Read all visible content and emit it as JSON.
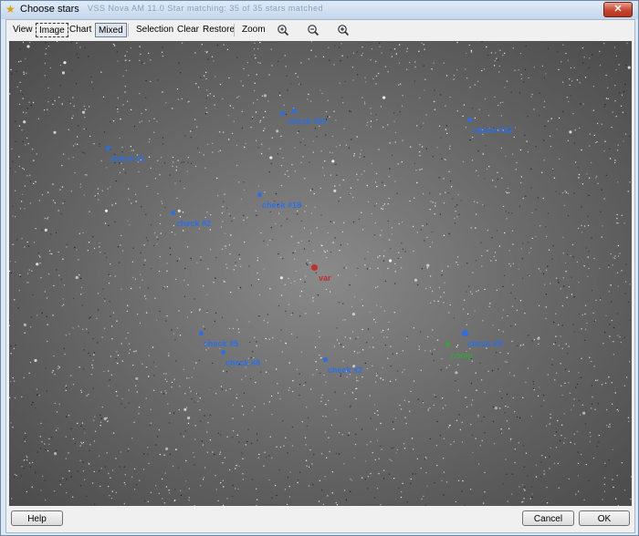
{
  "window": {
    "title": "Choose stars",
    "background_title": "VSS  Nova  AM  11.0  Star matching: 35 of 35 stars matched"
  },
  "toolbar": {
    "view": "View",
    "image": "Image",
    "chart": "Chart",
    "mixed": "Mixed",
    "selection": "Selection",
    "clear": "Clear",
    "restore": "Restore",
    "zoom": "Zoom",
    "zoom_fit_icon": "zoom-fit-icon",
    "zoom_out_icon": "zoom-out-icon",
    "zoom_in_icon": "zoom-in-icon"
  },
  "stars": [
    {
      "id": "check-31",
      "label": "check #31",
      "color": "#2a6fe8"
    },
    {
      "id": "check-33",
      "label": "check #33",
      "color": "#2a6fe8"
    },
    {
      "id": "check-41",
      "label": "check #1",
      "color": "#2a6fe8"
    },
    {
      "id": "check-18",
      "label": "check #18",
      "color": "#2a6fe8"
    },
    {
      "id": "check-42",
      "label": "check #2",
      "color": "#2a6fe8"
    },
    {
      "id": "var",
      "label": "var",
      "color": "#c0302c"
    },
    {
      "id": "check-35",
      "label": "check #5",
      "color": "#2a6fe8"
    },
    {
      "id": "check-48",
      "label": "check #8",
      "color": "#2a6fe8"
    },
    {
      "id": "check-32",
      "label": "check #2",
      "color": "#2a6fe8"
    },
    {
      "id": "check-9",
      "label": "check #9",
      "color": "#2a6fe8"
    },
    {
      "id": "comp",
      "label": "comp",
      "color": "#3ca03c"
    }
  ],
  "buttons": {
    "help": "Help",
    "cancel": "Cancel",
    "ok": "OK"
  }
}
